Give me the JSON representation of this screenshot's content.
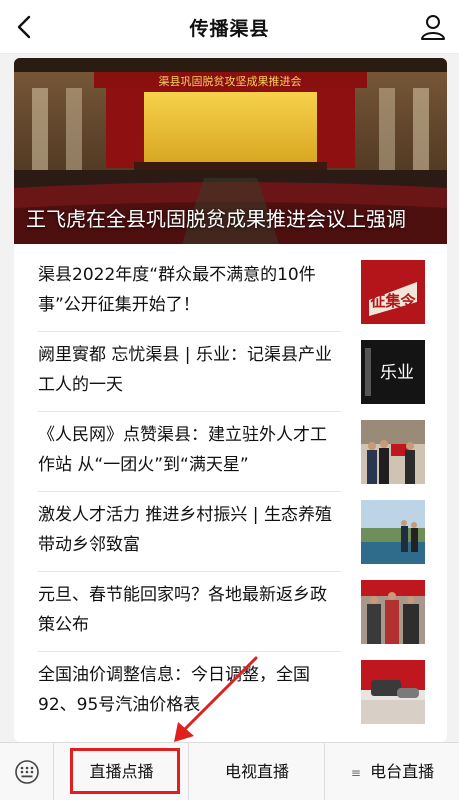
{
  "header": {
    "title": "传播渠县",
    "back_icon": "chevron-left-icon",
    "user_icon": "user-icon"
  },
  "hero": {
    "banner_text": "渠县巩固脱贫攻坚成果推进会",
    "title": "王飞虎在全县巩固脱贫成果推进会议上强调"
  },
  "articles": [
    {
      "title": "渠县2022年度“群众最不满意的10件事”公开征集开始了！",
      "thumb_text": "征集令"
    },
    {
      "title": "阙里賨都 忘忧渠县 | 乐业：记渠县产业工人的一天",
      "thumb_text": "乐业"
    },
    {
      "title": "《人民网》点赞渠县：建立驻外人才工作站 从“一团火”到“满天星”",
      "thumb_text": ""
    },
    {
      "title": "激发人才活力 推进乡村振兴 | 生态养殖带动乡邻致富",
      "thumb_text": ""
    },
    {
      "title": "元旦、春节能回家吗？各地最新返乡政策公布",
      "thumb_text": ""
    },
    {
      "title": "全国油价调整信息：今日调整，全国92、95号汽油价格表",
      "thumb_text": ""
    }
  ],
  "bottom_bar": {
    "keyboard_icon": "keyboard-icon",
    "tabs": [
      {
        "label": "直播点播"
      },
      {
        "label": "电视直播"
      },
      {
        "label": "电台直播",
        "icon": "≡"
      }
    ]
  },
  "colors": {
    "highlight": "#e02020",
    "accent_red": "#c0161d"
  }
}
